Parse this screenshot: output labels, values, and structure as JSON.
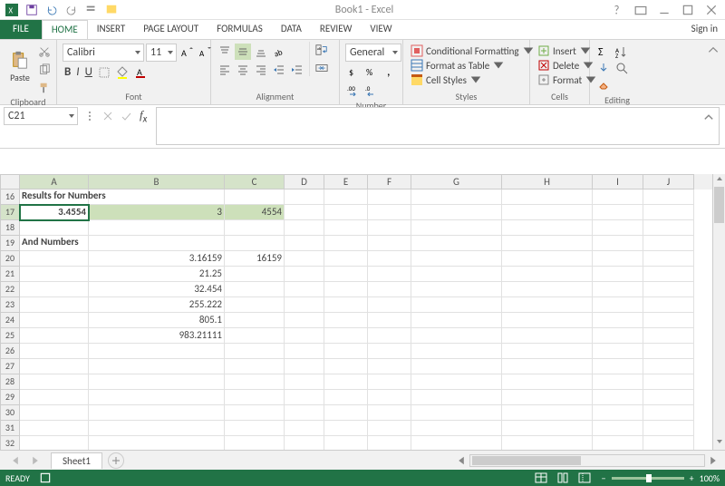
{
  "title": "Book1 - Excel",
  "qat_icons": [
    "excel-icon",
    "save-icon",
    "undo-icon",
    "redo-icon",
    "customize-icon",
    "touch-icon"
  ],
  "window_controls": [
    "help-icon",
    "ribbon-display-icon",
    "minimize-icon",
    "restore-icon",
    "close-icon"
  ],
  "tabs": [
    "FILE",
    "HOME",
    "INSERT",
    "PAGE LAYOUT",
    "FORMULAS",
    "DATA",
    "REVIEW",
    "VIEW"
  ],
  "active_tab": 1,
  "signin": "Sign in",
  "ribbon": {
    "clipboard": {
      "label": "Clipboard",
      "paste": "Paste"
    },
    "font": {
      "label": "Font",
      "name": "Calibri",
      "size": "11"
    },
    "alignment": {
      "label": "Alignment"
    },
    "number": {
      "label": "Number",
      "format": "General"
    },
    "styles": {
      "label": "Styles",
      "items": [
        "Conditional Formatting",
        "Format as Table",
        "Cell Styles"
      ]
    },
    "cells": {
      "label": "Cells",
      "items": [
        "Insert",
        "Delete",
        "Format"
      ]
    },
    "editing": {
      "label": "Editing"
    }
  },
  "namebox": "C21",
  "formula": "",
  "columns": [
    "A",
    "B",
    "C",
    "D",
    "E",
    "F",
    "G",
    "H",
    "I",
    "J"
  ],
  "rows": [
    {
      "n": 16,
      "cells": [
        {
          "v": "Results for Numbers",
          "cls": "bold",
          "overflow": true
        },
        "",
        "",
        "",
        "",
        "",
        "",
        "",
        "",
        ""
      ]
    },
    {
      "n": 17,
      "sel": true,
      "cells": [
        {
          "v": "3.4554",
          "cls": "right bold activesel"
        },
        {
          "v": "3",
          "cls": "right selrange"
        },
        {
          "v": "4554",
          "cls": "right selrange"
        },
        "",
        "",
        "",
        "",
        "",
        "",
        ""
      ]
    },
    {
      "n": 18,
      "cells": [
        "",
        "",
        "",
        "",
        "",
        "",
        "",
        "",
        "",
        ""
      ]
    },
    {
      "n": 19,
      "cells": [
        {
          "v": "And Numbers",
          "cls": "bold",
          "overflow": true
        },
        "",
        "",
        "",
        "",
        "",
        "",
        "",
        "",
        ""
      ]
    },
    {
      "n": 20,
      "cells": [
        "",
        {
          "v": "3.16159",
          "cls": "right"
        },
        {
          "v": "16159",
          "cls": "right"
        },
        "",
        "",
        "",
        "",
        "",
        "",
        ""
      ]
    },
    {
      "n": 21,
      "cells": [
        "",
        {
          "v": "21.25",
          "cls": "right"
        },
        "",
        "",
        "",
        "",
        "",
        "",
        "",
        ""
      ]
    },
    {
      "n": 22,
      "cells": [
        "",
        {
          "v": "32.454",
          "cls": "right"
        },
        "",
        "",
        "",
        "",
        "",
        "",
        "",
        ""
      ]
    },
    {
      "n": 23,
      "cells": [
        "",
        {
          "v": "255.222",
          "cls": "right"
        },
        "",
        "",
        "",
        "",
        "",
        "",
        "",
        ""
      ]
    },
    {
      "n": 24,
      "cells": [
        "",
        {
          "v": "805.1",
          "cls": "right"
        },
        "",
        "",
        "",
        "",
        "",
        "",
        "",
        ""
      ]
    },
    {
      "n": 25,
      "cells": [
        "",
        {
          "v": "983.21111",
          "cls": "right"
        },
        "",
        "",
        "",
        "",
        "",
        "",
        "",
        ""
      ]
    },
    {
      "n": 26,
      "cells": [
        "",
        "",
        "",
        "",
        "",
        "",
        "",
        "",
        "",
        ""
      ]
    },
    {
      "n": 27,
      "cells": [
        "",
        "",
        "",
        "",
        "",
        "",
        "",
        "",
        "",
        ""
      ]
    },
    {
      "n": 28,
      "cells": [
        "",
        "",
        "",
        "",
        "",
        "",
        "",
        "",
        "",
        ""
      ]
    },
    {
      "n": 29,
      "cells": [
        "",
        "",
        "",
        "",
        "",
        "",
        "",
        "",
        "",
        ""
      ]
    },
    {
      "n": 30,
      "cells": [
        "",
        "",
        "",
        "",
        "",
        "",
        "",
        "",
        "",
        ""
      ]
    },
    {
      "n": 31,
      "cells": [
        "",
        "",
        "",
        "",
        "",
        "",
        "",
        "",
        "",
        ""
      ]
    },
    {
      "n": 32,
      "cells": [
        "",
        "",
        "",
        "",
        "",
        "",
        "",
        "",
        "",
        ""
      ]
    }
  ],
  "sel_cols": [
    0,
    1,
    2
  ],
  "sheets": [
    "Sheet1"
  ],
  "status": {
    "ready": "READY",
    "zoom": "100%"
  }
}
